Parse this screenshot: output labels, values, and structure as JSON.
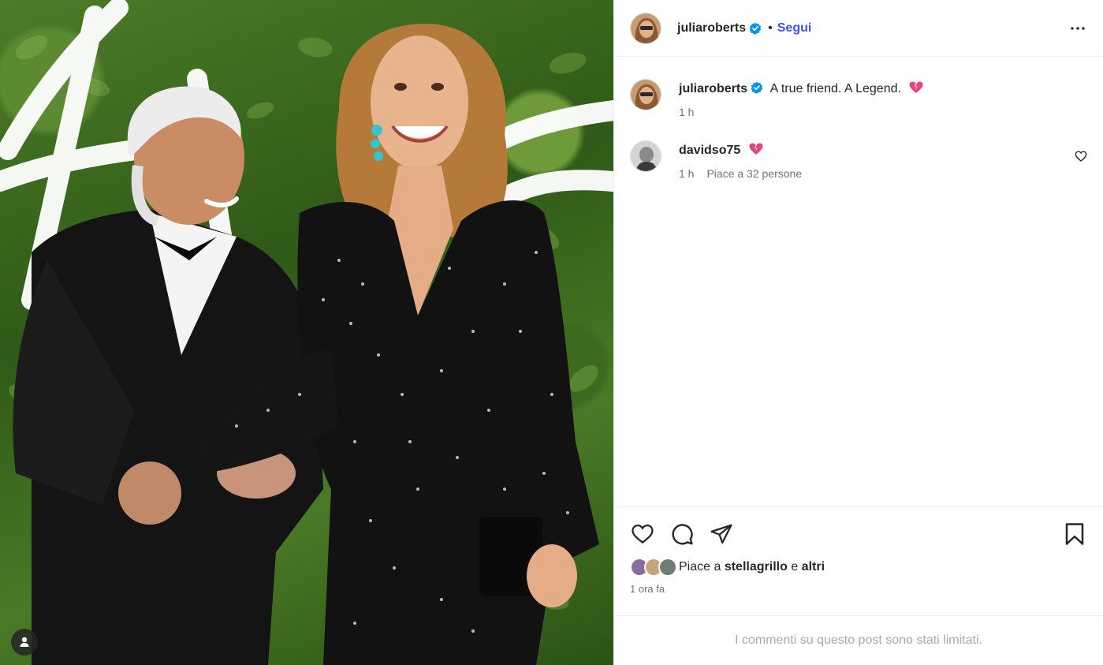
{
  "header": {
    "username": "juliaroberts",
    "separator": "•",
    "follow_label": "Segui",
    "more_icon": "more-horizontal-icon"
  },
  "caption": {
    "username": "juliaroberts",
    "text": "A true friend. A Legend.",
    "time": "1 h"
  },
  "comments": [
    {
      "username": "davidso75",
      "time": "1 h",
      "likes": "Piace a 32 persone"
    }
  ],
  "likes": {
    "prefix": "Piace a",
    "user": "stellagrillo",
    "conj": "e",
    "others": "altri"
  },
  "post_time": "1 ora fa",
  "limited_notice": "I commenti su questo post sono stati limitati.",
  "colors": {
    "link": "#4150f7",
    "verified": "#0095f6",
    "broken_heart": "#e8457a",
    "meta": "#737373"
  }
}
